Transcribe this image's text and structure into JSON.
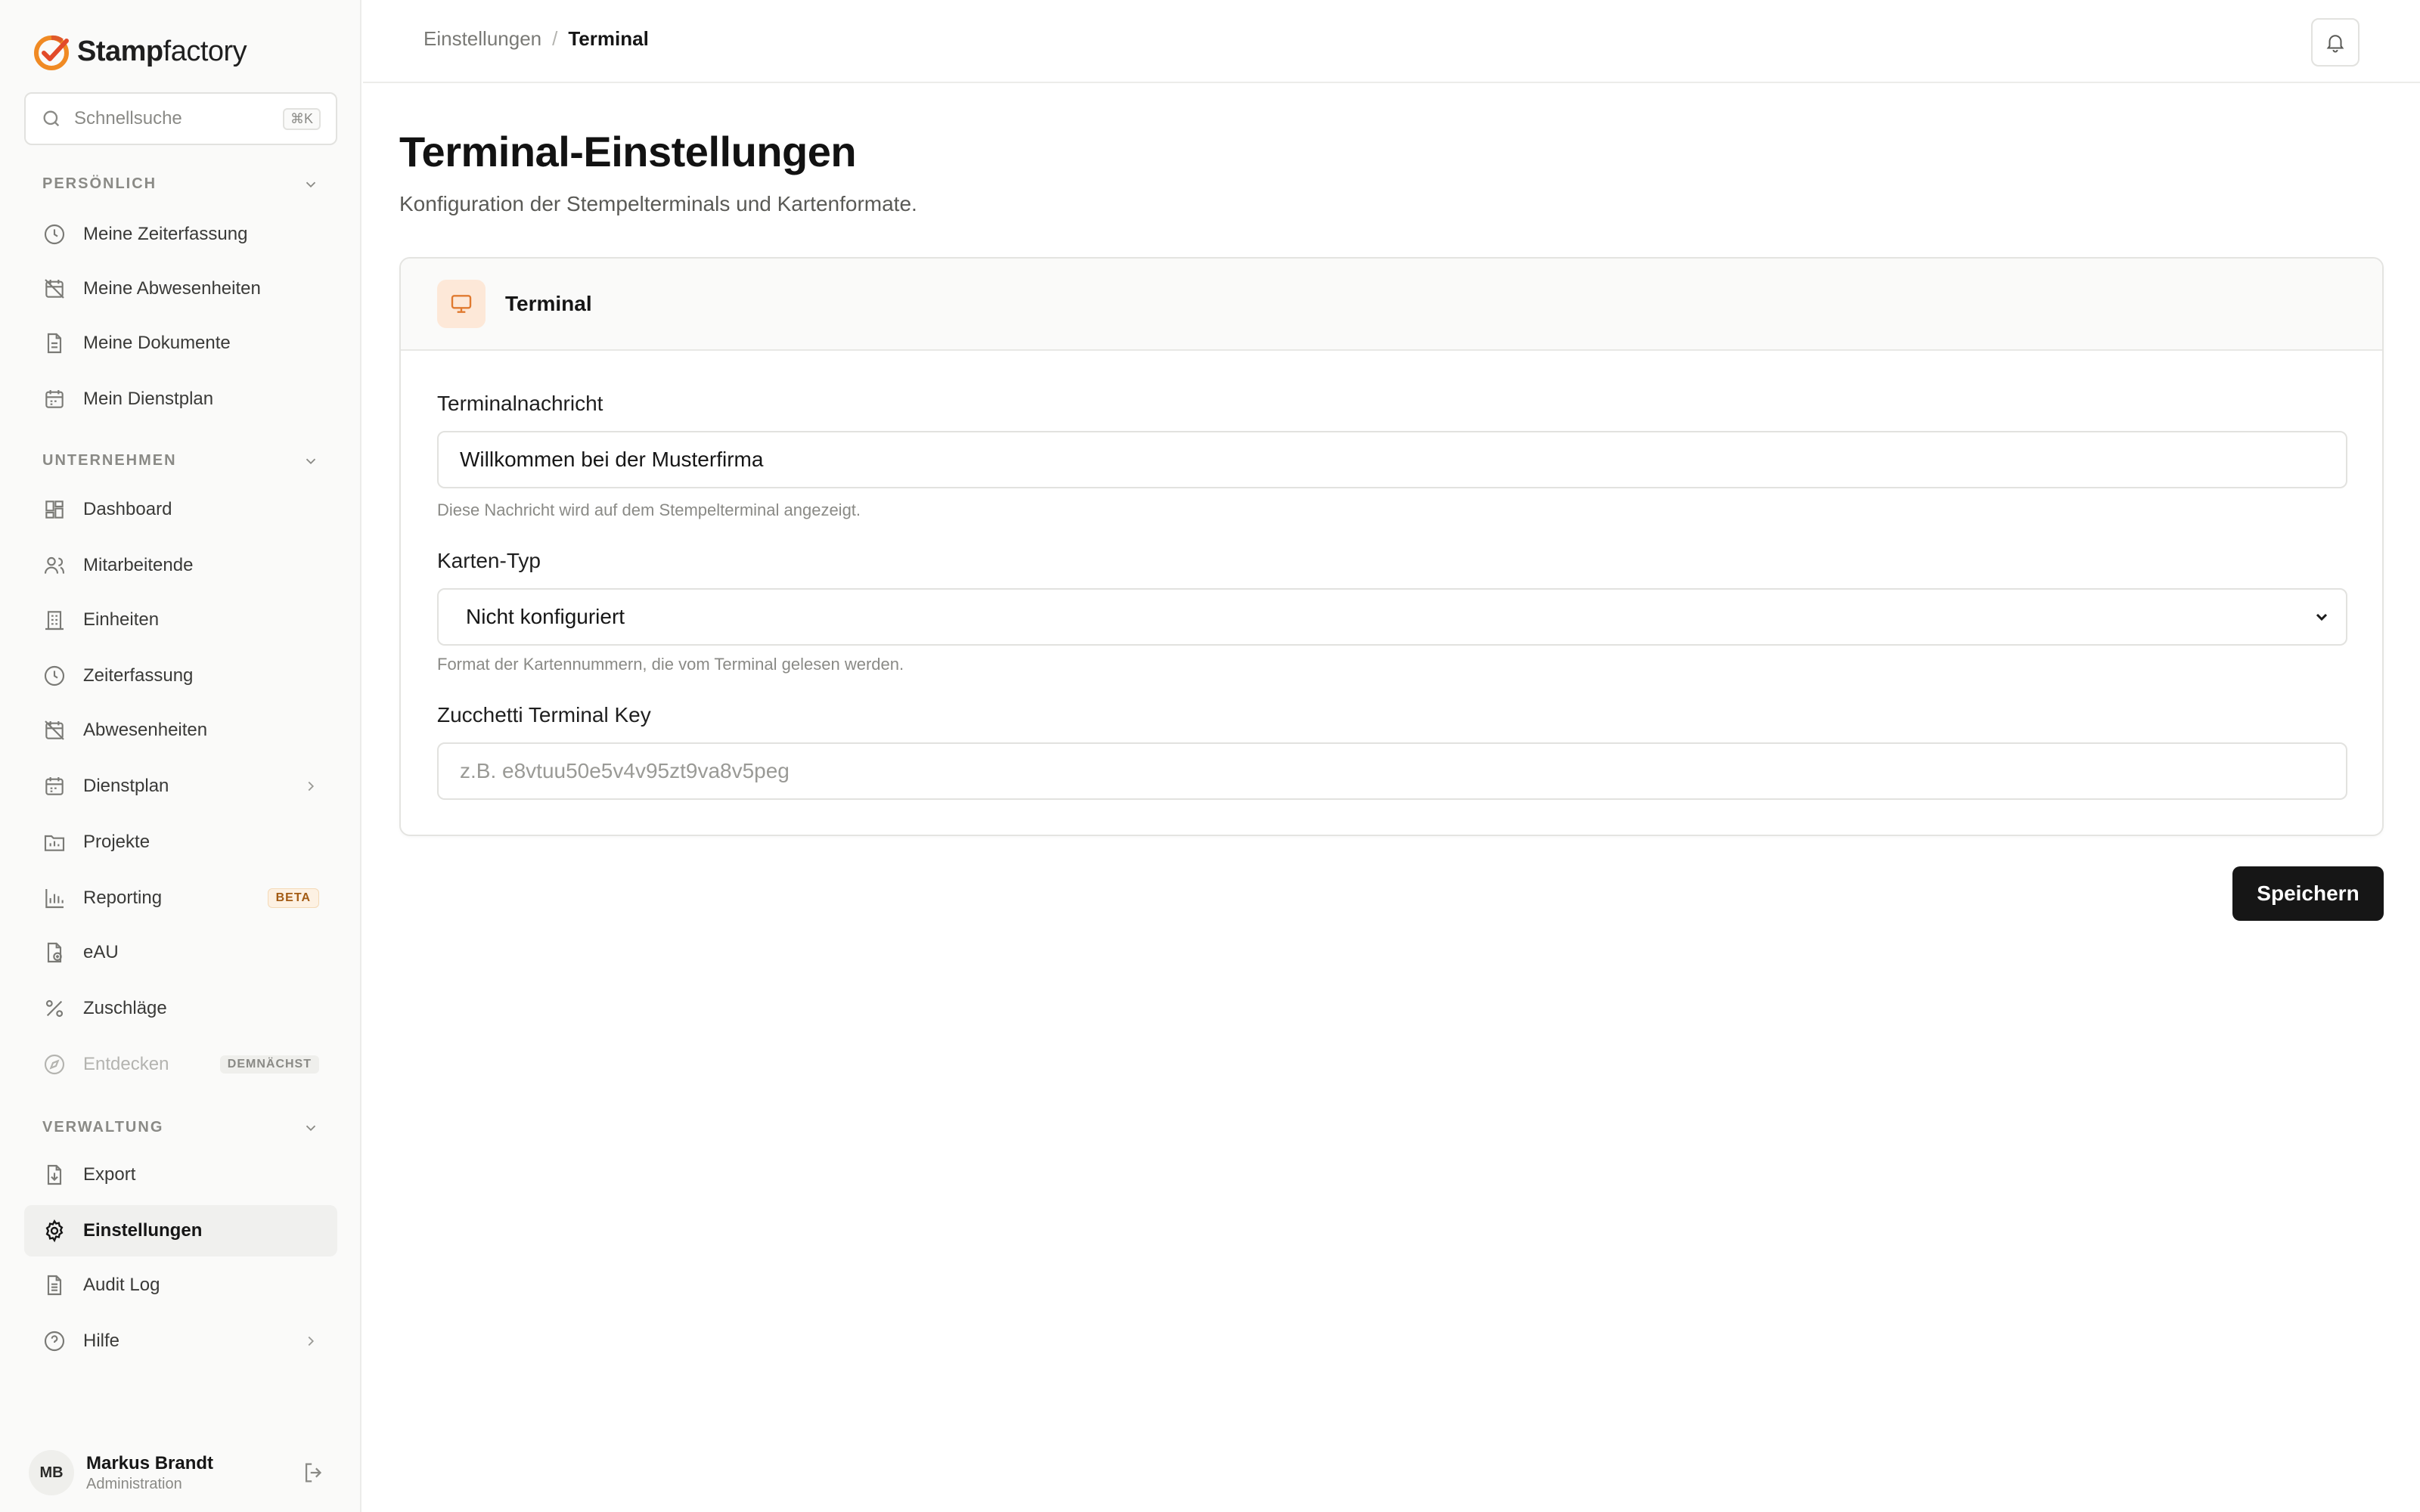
{
  "brand": {
    "name_bold": "Stamp",
    "name_light": "factory",
    "accent": "#f08a24"
  },
  "search": {
    "placeholder": "Schnellsuche",
    "shortcut": "⌘K"
  },
  "sections": {
    "personal": "PERSÖNLICH",
    "company": "UNTERNEHMEN",
    "admin": "VERWALTUNG"
  },
  "nav": {
    "personal": [
      {
        "label": "Meine Zeiterfassung",
        "icon": "clock-icon"
      },
      {
        "label": "Meine Abwesenheiten",
        "icon": "calendar-off-icon"
      },
      {
        "label": "Meine Dokumente",
        "icon": "document-icon"
      },
      {
        "label": "Mein Dienstplan",
        "icon": "calendar-icon"
      }
    ],
    "company": [
      {
        "label": "Dashboard",
        "icon": "dashboard-icon"
      },
      {
        "label": "Mitarbeitende",
        "icon": "users-icon"
      },
      {
        "label": "Einheiten",
        "icon": "building-icon"
      },
      {
        "label": "Zeiterfassung",
        "icon": "clock-icon"
      },
      {
        "label": "Abwesenheiten",
        "icon": "calendar-off-icon"
      },
      {
        "label": "Dienstplan",
        "icon": "calendar-icon"
      },
      {
        "label": "Projekte",
        "icon": "folder-icon"
      },
      {
        "label": "Reporting",
        "icon": "bar-chart-icon",
        "badge": "BETA"
      },
      {
        "label": "eAU",
        "icon": "file-health-icon"
      },
      {
        "label": "Zuschläge",
        "icon": "percent-icon"
      },
      {
        "label": "Entdecken",
        "icon": "compass-icon",
        "badge": "DEMNÄCHST"
      }
    ],
    "admin": [
      {
        "label": "Export",
        "icon": "file-download-icon"
      },
      {
        "label": "Einstellungen",
        "icon": "gear-icon",
        "active": true
      },
      {
        "label": "Audit Log",
        "icon": "document-list-icon"
      },
      {
        "label": "Hilfe",
        "icon": "help-circle-icon"
      }
    ]
  },
  "user": {
    "initials": "MB",
    "name": "Markus Brandt",
    "role": "Administration"
  },
  "breadcrumb": {
    "parent": "Einstellungen",
    "separator": "/",
    "current": "Terminal"
  },
  "page": {
    "title": "Terminal-Einstellungen",
    "subtitle": "Konfiguration der Stempelterminals und Kartenformate."
  },
  "card": {
    "title": "Terminal",
    "message": {
      "label": "Terminalnachricht",
      "value": "Willkommen bei der Musterfirma",
      "hint": "Diese Nachricht wird auf dem Stempelterminal angezeigt."
    },
    "card_type": {
      "label": "Karten-Typ",
      "selected": "Nicht konfiguriert",
      "hint": "Format der Kartennummern, die vom Terminal gelesen werden."
    },
    "terminal_key": {
      "label": "Zucchetti Terminal Key",
      "placeholder": "z.B. e8vtuu50e5v4v95zt9va8v5peg"
    }
  },
  "actions": {
    "save": "Speichern"
  }
}
